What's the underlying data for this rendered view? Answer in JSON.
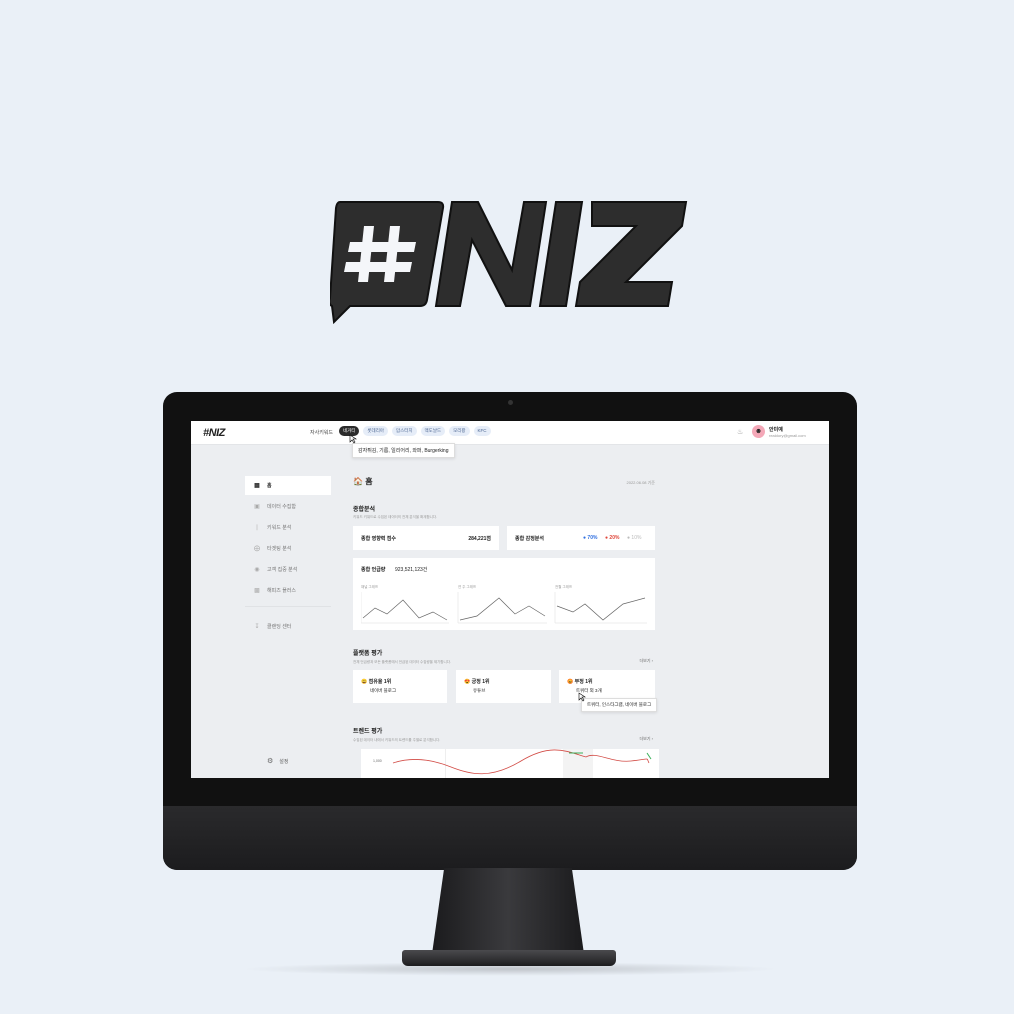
{
  "brand": {
    "name": "NIZ"
  },
  "topbar": {
    "logo": "NIZ",
    "keyword_label": "자사키워드",
    "keywords": [
      "네거티",
      "롯데리아",
      "맘스터치",
      "맥도날드",
      "모리꽝",
      "KFC"
    ],
    "active_keyword_index": 0,
    "tooltip": "감자튀김, 기름, 일리어리, 와퍼, Burgerking",
    "user": {
      "name": "안미예",
      "email": "realdory@gmail.com"
    }
  },
  "sidebar": {
    "items": [
      {
        "label": "홈",
        "icon": "dashboard-icon"
      },
      {
        "label": "데이터 수집함",
        "icon": "box-icon"
      },
      {
        "label": "키워드 분석",
        "icon": "bar-chart-icon"
      },
      {
        "label": "타겟팅 분석",
        "icon": "target-icon"
      },
      {
        "label": "고객 집중 분석",
        "icon": "compass-icon"
      },
      {
        "label": "해피즈 플러스",
        "icon": "folder-icon"
      }
    ],
    "extra_item": {
      "label": "클랜딩 센터",
      "icon": "download-icon"
    },
    "settings_label": "설정"
  },
  "main": {
    "title": "홈",
    "date": "2022.06.08 기준",
    "overall": {
      "title": "종합분석",
      "desc": "키워드 키워드로 수집된 데이터의 전체 분석을 확계합니다.",
      "influence_label": "종합 영향력 점수",
      "influence_value": "284,221점",
      "sentiment_label": "종합 감정분석",
      "sentiment": [
        {
          "value": "70%",
          "color": "#2f6fe0"
        },
        {
          "value": "20%",
          "color": "#e0463a"
        },
        {
          "value": "10%",
          "color": "#bbbbbb"
        }
      ],
      "mentions_label": "종합 언급량",
      "mentions_value": "923,521,123건",
      "mini_charts": [
        "채널 그래프",
        "연 주 그래프",
        "전월 그래프"
      ]
    },
    "platform": {
      "title": "플랫폼 평가",
      "desc": "전체 언급량과 모든 플랫폼에서 언급된 데이터 수집량을 제기합니다.",
      "more": "더보기",
      "cards": [
        {
          "emoji": "😀",
          "label": "점유율 1위",
          "value": "네이버 블로그"
        },
        {
          "emoji": "😍",
          "label": "긍정 1위",
          "value": "유튜브"
        },
        {
          "emoji": "😡",
          "label": "부정 1위",
          "value": "트위터 외 3개"
        }
      ],
      "tooltip": "트위터, 인스타그램, 네이버 블로그"
    },
    "trend": {
      "title": "트렌드 평가",
      "desc": "수집된 데이터 내에서 키워드의 트렌드를 주별로 분석합니다.",
      "more": "더보기",
      "ytick": "1,000"
    }
  }
}
